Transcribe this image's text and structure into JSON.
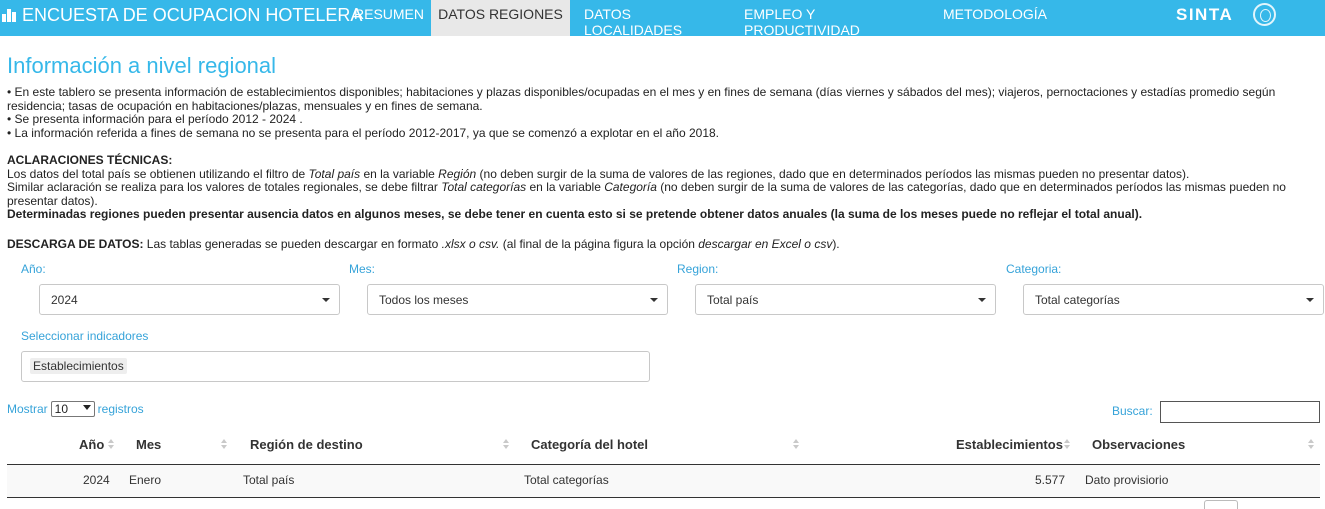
{
  "header": {
    "app_title": "ENCUESTA DE OCUPACION HOTELERA",
    "tabs": [
      "RESUMEN",
      "DATOS REGIONES",
      "DATOS LOCALIDADES",
      "EMPLEO Y PRODUCTIVIDAD",
      "METODOLOGÍA"
    ],
    "active_tab": "DATOS REGIONES",
    "brand": "SINTA",
    "colors": {
      "nav_bg": "#36b8e9",
      "accent": "#36a3d9"
    }
  },
  "page": {
    "title": "Información a nivel regional",
    "intro": [
      "• En este tablero se presenta información de establecimientos disponibles; habitaciones y plazas disponibles/ocupadas en el mes y en fines de semana (días viernes y sábados del mes); viajeros, pernoctaciones y estadías promedio según residencia; tasas de ocupación en habitaciones/plazas, mensuales y en fines de semana.",
      "• Se presenta información para el período 2012 - 2024 .",
      "• La información referida a fines de semana no se presenta para el período 2012-2017, ya que se comenzó a explotar en el año 2018."
    ],
    "tech": {
      "heading": "ACLARACIONES TÉCNICAS:",
      "line1": {
        "a": "Los datos del total país se obtienen utilizando el filtro de ",
        "b": "Total país",
        "c": " en la variable ",
        "d": "Región",
        "e": " (no deben surgir de la suma de valores de las regiones, dado que en determinados períodos las mismas pueden no presentar datos)."
      },
      "line2": {
        "a": "Similar aclaración se realiza para los valores de totales regionales, se debe filtrar ",
        "b": "Total categorías",
        "c": " en la variable ",
        "d": "Categoría",
        "e": " (no deben surgir de la suma de valores de las categorías, dado que en determinados períodos las mismas pueden no presentar datos)."
      },
      "strong": "Determinadas regiones pueden presentar ausencia datos en algunos meses, se debe tener en cuenta esto si se pretende obtener datos anuales (la suma de los meses puede no reflejar el total anual)."
    },
    "download": {
      "label": "DESCARGA DE DATOS:",
      "a": " Las tablas generadas se pueden descargar en formato ",
      "b": ".xlsx o csv.",
      "c": " (al final de la página figura la opción ",
      "d": "descargar en Excel o csv",
      "e": ")."
    }
  },
  "filters": {
    "year": {
      "label": "Año:",
      "value": "2024"
    },
    "month": {
      "label": "Mes:",
      "value": "Todos los meses"
    },
    "region": {
      "label": "Region:",
      "value": "Total país"
    },
    "category": {
      "label": "Categoria:",
      "value": "Total categorías"
    },
    "indicators": {
      "label": "Seleccionar indicadores",
      "selected": "Establecimientos"
    }
  },
  "table_controls": {
    "show_prefix": "Mostrar",
    "page_length": "10",
    "show_suffix": "registros",
    "search_label": "Buscar:",
    "search_value": ""
  },
  "table": {
    "columns": [
      "Año",
      "Mes",
      "Región de destino",
      "Categoría del hotel",
      "Establecimientos",
      "Observaciones"
    ],
    "rows": [
      {
        "year": "2024",
        "month": "Enero",
        "region": "Total país",
        "category": "Total categorías",
        "establishments": "5.577",
        "notes": "Dato provisiorio"
      }
    ]
  }
}
